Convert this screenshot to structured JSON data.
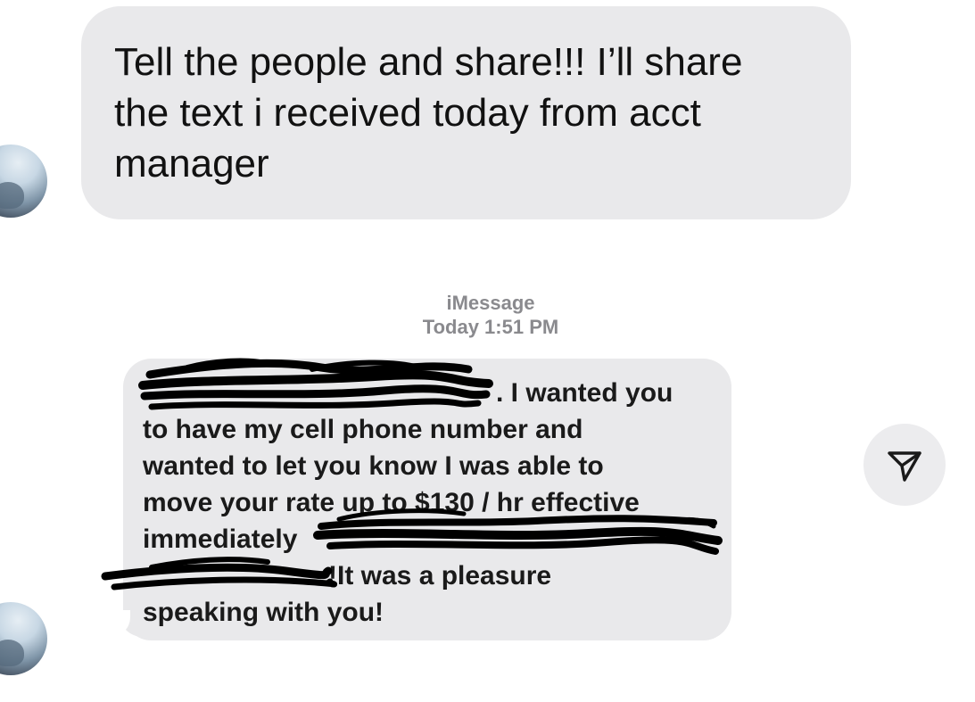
{
  "conversation": {
    "message_1": {
      "lines": [
        "Tell the people and share!!! I’ll share",
        "the text i received today from acct",
        "manager"
      ]
    },
    "separator": {
      "service": "iMessage",
      "timestamp": "Today 1:51 PM"
    },
    "message_2": {
      "lines": [
        ". I wanted you",
        "to have my cell phone number and",
        "wanted to let you know I was able to",
        "move your rate up to $130 / hr effective",
        "immediately",
        "!It was a pleasure",
        "speaking with you!"
      ]
    }
  },
  "icons": {
    "avatar": "contact-avatar",
    "share": "paper-plane-share-icon"
  },
  "colors": {
    "bubble": "#e9e9eb",
    "meta_text": "#8a8a8e",
    "redaction": "#000000"
  }
}
